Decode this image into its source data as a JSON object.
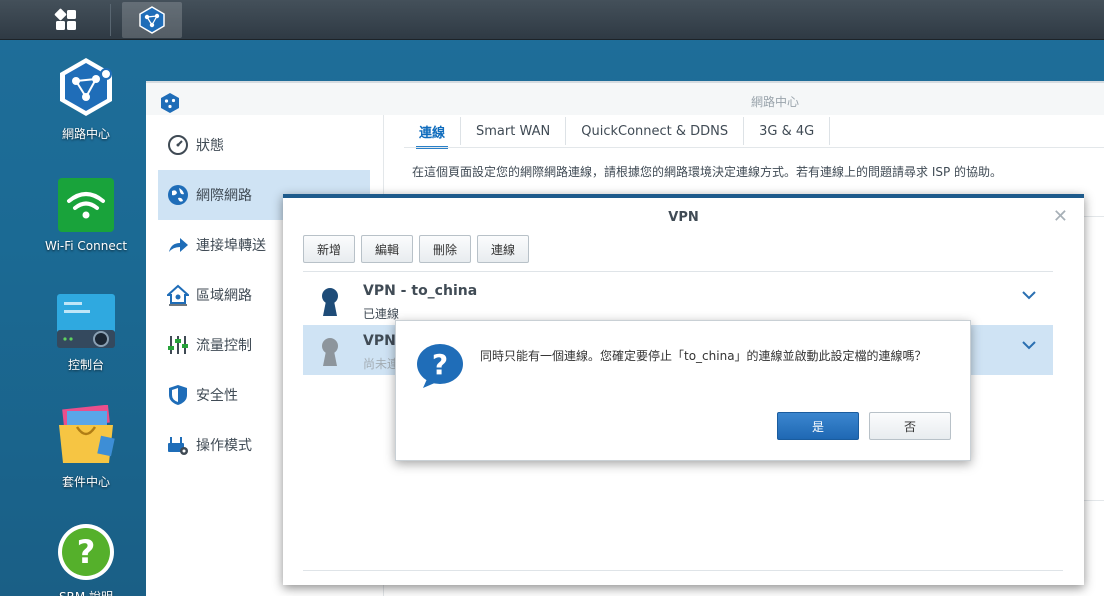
{
  "taskbar": {
    "main_menu_icon": "grid-icon",
    "active_app_icon": "network-center-icon"
  },
  "desktop": {
    "icons": [
      {
        "label": "網路中心",
        "icon": "network-center-icon"
      },
      {
        "label": "Wi-Fi Connect",
        "icon": "wifi-icon"
      },
      {
        "label": "控制台",
        "icon": "control-panel-icon"
      },
      {
        "label": "套件中心",
        "icon": "package-center-icon"
      },
      {
        "label": "SRM 說明",
        "icon": "help-icon"
      }
    ]
  },
  "window": {
    "title": "網路中心",
    "sidebar": [
      {
        "label": "狀態",
        "icon": "gauge-icon"
      },
      {
        "label": "網際網路",
        "icon": "globe-icon"
      },
      {
        "label": "連接埠轉送",
        "icon": "forward-arrow-icon"
      },
      {
        "label": "區域網路",
        "icon": "home-network-icon"
      },
      {
        "label": "流量控制",
        "icon": "sliders-icon"
      },
      {
        "label": "安全性",
        "icon": "shield-icon"
      },
      {
        "label": "操作模式",
        "icon": "router-mode-icon"
      }
    ],
    "active_sidebar": "網際網路",
    "tabs": [
      "連線",
      "Smart WAN",
      "QuickConnect & DDNS",
      "3G & 4G"
    ],
    "active_tab": "連線",
    "description": "在這個頁面設定您的網際網路連線，請根據您的網路環境決定連線方式。若有連線上的問題請尋求 ISP 的協助。"
  },
  "vpn_dialog": {
    "title": "VPN",
    "toolbar": {
      "add": "新增",
      "edit": "編輯",
      "delete": "刪除",
      "connect": "連線"
    },
    "profiles": [
      {
        "name": "VPN - to_china",
        "status": "已連線"
      },
      {
        "name": "VPN",
        "status": "尚未連"
      }
    ]
  },
  "confirm_dialog": {
    "message": "同時只能有一個連線。您確定要停止「to_china」的連線並啟動此設定檔的連線嗎？",
    "yes_label": "是",
    "no_label": "否"
  },
  "colors": {
    "desktop_bg": "#1b6a94",
    "accent": "#1f68b3",
    "selection": "#cfe3f4"
  }
}
